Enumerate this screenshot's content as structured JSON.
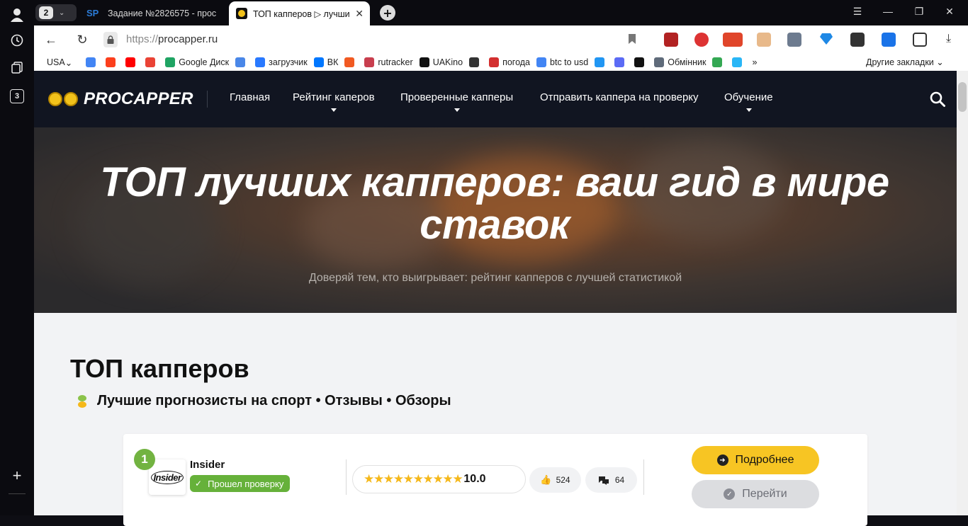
{
  "browser": {
    "tab_count": "2",
    "tabs": [
      {
        "title": "Задание №2826575 - прос",
        "favicon_text": "SP"
      },
      {
        "title": "ТОП капперов ▷ лучши",
        "favicon_text": ""
      }
    ],
    "url_protocol": "https://",
    "url_host": "procapper.ru",
    "rail_badge": "3",
    "bookmarks": [
      {
        "label": "USA",
        "color": "#ffffff"
      },
      {
        "label": "",
        "color": "#4285f4"
      },
      {
        "label": "",
        "color": "#fc3f1d"
      },
      {
        "label": "",
        "color": "#ff0000"
      },
      {
        "label": "",
        "color": "#ea4335"
      },
      {
        "label": "Google Диск",
        "color": "#1fa463"
      },
      {
        "label": "",
        "color": "#4a87e8"
      },
      {
        "label": "загрузчик",
        "color": "#2979ff"
      },
      {
        "label": "ВК",
        "color": "#0077ff"
      },
      {
        "label": "",
        "color": "#f15a22"
      },
      {
        "label": "rutracker",
        "color": "#c83e4e"
      },
      {
        "label": "UAKino",
        "color": "#111111"
      },
      {
        "label": "",
        "color": "#333333"
      },
      {
        "label": "погода",
        "color": "#d32f2f"
      },
      {
        "label": "btc to usd",
        "color": "#4285f4"
      },
      {
        "label": "",
        "color": "#2196f3"
      },
      {
        "label": "",
        "color": "#5b6bf5"
      },
      {
        "label": "",
        "color": "#111111"
      },
      {
        "label": "Обмінник",
        "color": "#5f6b7a"
      },
      {
        "label": "",
        "color": "#34a853"
      },
      {
        "label": "",
        "color": "#29b6f6"
      }
    ],
    "bookmarks_more": "»",
    "other_bookmarks": "Другие закладки"
  },
  "site": {
    "logo_text": "PROCAPPER",
    "menu": [
      {
        "label": "Главная",
        "has_caret": false
      },
      {
        "label": "Рейтинг каперов",
        "has_caret": true
      },
      {
        "label": "Проверенные капперы",
        "has_caret": true
      },
      {
        "label": "Отправить каппера на проверку",
        "has_caret": false
      },
      {
        "label": "Обучение",
        "has_caret": true
      }
    ],
    "hero_title_line1": "ТОП лучших капперов: ваш гид в мире",
    "hero_title_line2": "ставок",
    "hero_subtitle": "Доверяй тем, кто выигрывает: рейтинг капперов с лучшей статистикой",
    "section_title": "ТОП капперов",
    "section_subtitle": "Лучшие прогнозисты на спорт • Отзывы • Обзоры"
  },
  "capper": {
    "rank": "1",
    "avatar_text": "Insider",
    "name": "Insider",
    "verified_label": "Прошел проверку",
    "stars": "★★★★★★★★★★",
    "rating": "10.0",
    "likes": "524",
    "comments": "64",
    "more_label": "Подробнее",
    "go_label": "Перейти"
  },
  "colors": {
    "accent_yellow": "#f7c523",
    "verified_green": "#66b13a",
    "header_bg": "#111521"
  }
}
